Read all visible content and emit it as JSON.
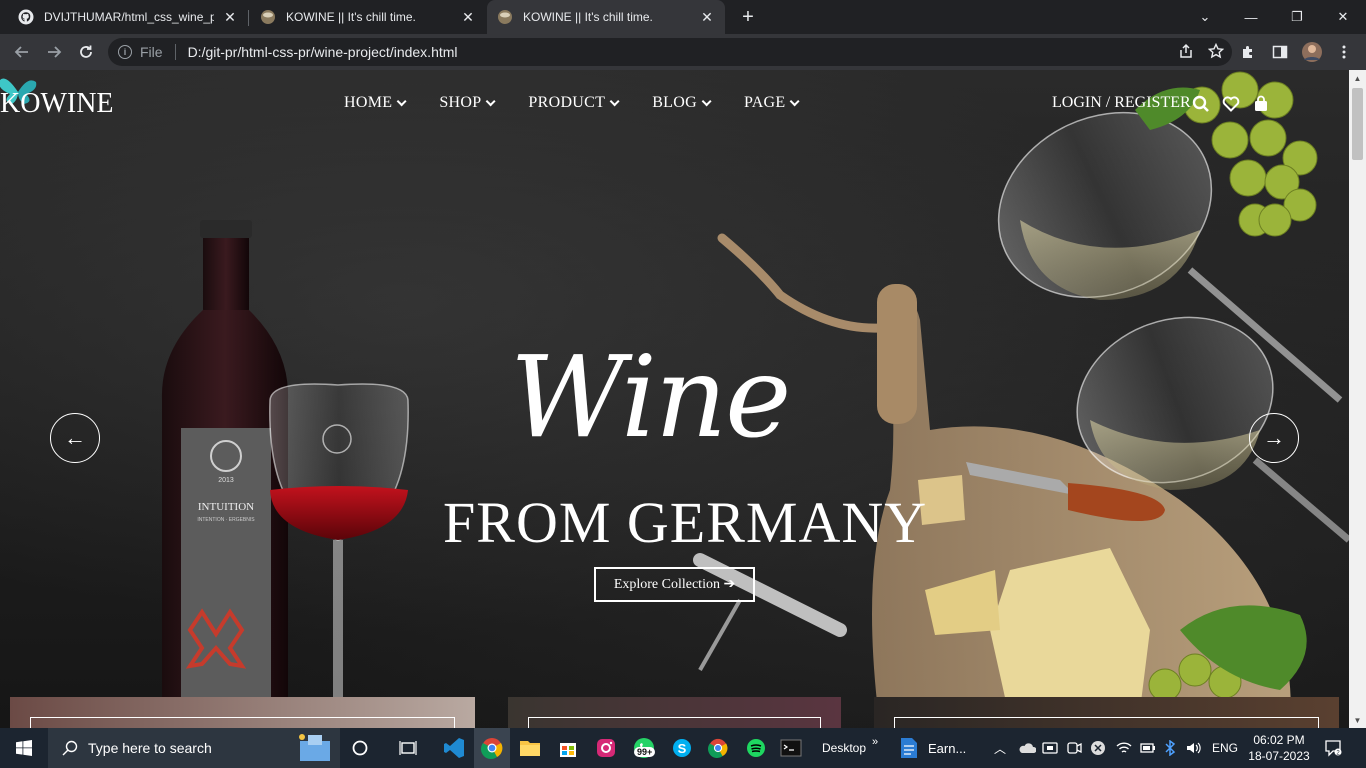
{
  "browser": {
    "tabs": [
      {
        "title": "DVIJTHUMAR/html_css_wine_pro",
        "active": false,
        "favicon": "github-icon"
      },
      {
        "title": "KOWINE || It's chill time.",
        "active": false,
        "favicon": "wine-favicon"
      },
      {
        "title": "KOWINE || It's chill time.",
        "active": true,
        "favicon": "wine-favicon"
      }
    ],
    "address": {
      "scheme_label": "File",
      "url": "D:/git-pr/html-css-pr/wine-project/index.html"
    }
  },
  "site": {
    "logo": "KOWINE",
    "nav": [
      {
        "label": "HOME"
      },
      {
        "label": "SHOP"
      },
      {
        "label": "PRODUCT"
      },
      {
        "label": "BLOG"
      },
      {
        "label": "PAGE"
      }
    ],
    "login": "LOGIN / REGISTER",
    "hero": {
      "script": "Wine",
      "title": "FROM GERMANY",
      "cta": "Explore Collection ➔",
      "prev": "←",
      "next": "→"
    },
    "bottle_label": {
      "year": "2013",
      "name": "INTUITION",
      "sub": "INTENTION · ERGEBNIS"
    }
  },
  "taskbar": {
    "search_placeholder": "Type here to search",
    "desktop_label": "Desktop",
    "earn_label": "Earn...",
    "whatsapp_badge": "99+",
    "lang": "ENG",
    "time": "06:02 PM",
    "date": "18-07-2023"
  },
  "colors": {
    "accent_teal": "#3ec7c7",
    "wine_red": "#8b0d12",
    "chrome_dark": "#202124",
    "taskbar": "#1c2530"
  }
}
